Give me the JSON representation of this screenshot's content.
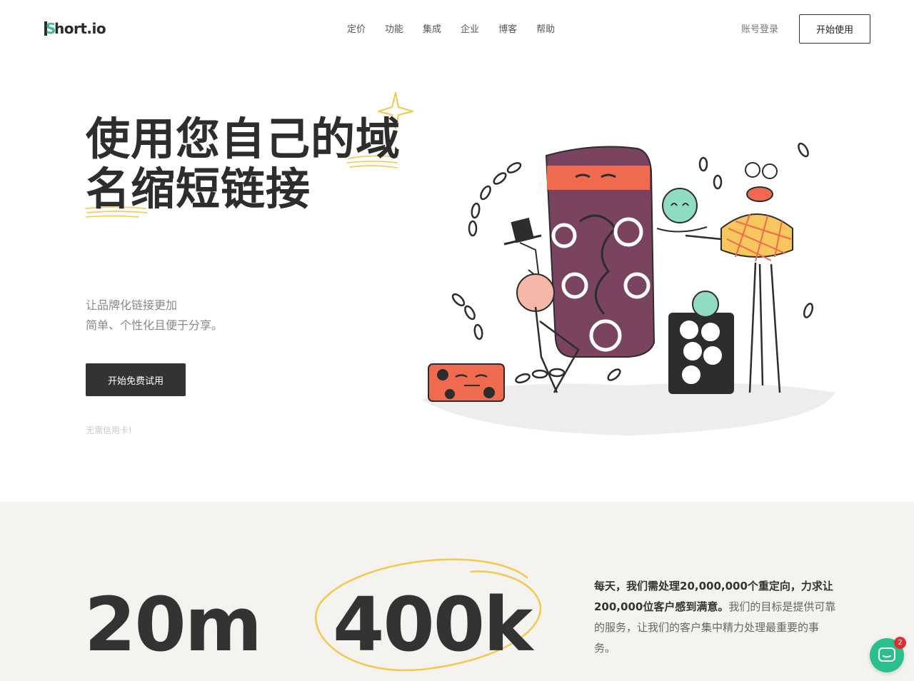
{
  "header": {
    "logo_text": "hort.io",
    "logo_letter": "S",
    "nav": [
      "定价",
      "功能",
      "集成",
      "企业",
      "博客",
      "帮助"
    ],
    "login_label": "账号登录",
    "start_label": "开始使用"
  },
  "hero": {
    "title_line1": "使用您自己的域",
    "title_line2": "名缩短链接",
    "subtitle_line1": "让品牌化链接更加",
    "subtitle_line2": "简单、个性化且便于分享。",
    "cta_label": "开始免费试用",
    "note": "无需信用卡!"
  },
  "stats": {
    "stat1": "20m",
    "stat2": "400k",
    "text_bold": "每天，我们需处理20,000,000个重定向，力求让200,000位客户感到满意。",
    "text_rest": "我们的目标是提供可靠的服务，让我们的客户集中精力处理最重要的事务。"
  },
  "chat": {
    "badge_count": "2"
  },
  "colors": {
    "accent_green": "#2bbf8e",
    "highlight_yellow": "#f2c94c",
    "dark_button": "#333333",
    "stats_bg": "#f5f3f0"
  }
}
